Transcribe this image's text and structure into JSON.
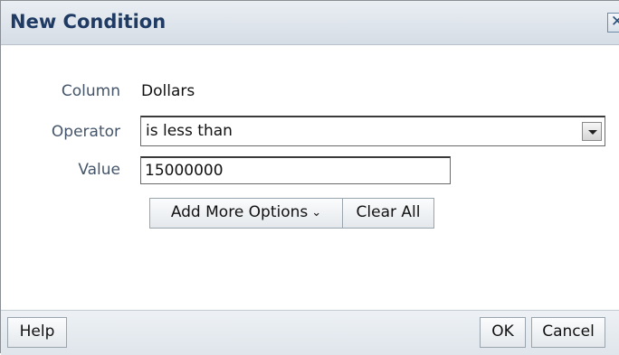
{
  "dialog": {
    "title": "New Condition",
    "close_icon": "close-icon"
  },
  "form": {
    "column_label": "Column",
    "column_value": "Dollars",
    "operator_label": "Operator",
    "operator_selected": "is less than",
    "value_label": "Value",
    "value_input": "15000000"
  },
  "buttons": {
    "add_more_options": "Add More Options",
    "add_more_options_icon": "chevron-down-icon",
    "clear_all": "Clear All",
    "help": "Help",
    "ok": "OK",
    "cancel": "Cancel"
  }
}
